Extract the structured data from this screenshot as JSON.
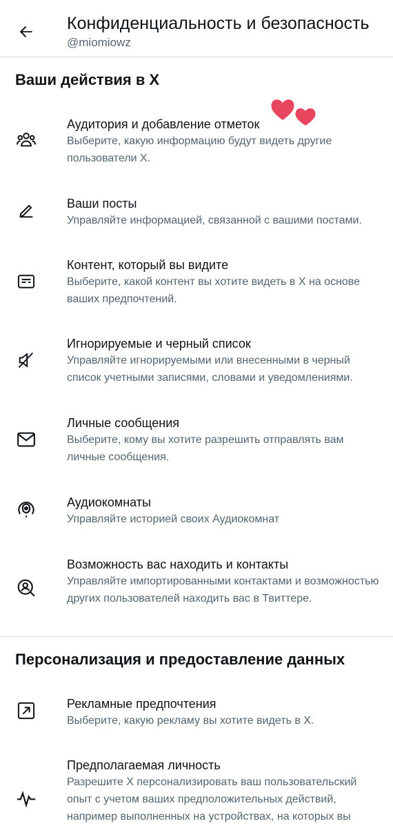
{
  "header": {
    "title": "Конфиденциальность и безопасность",
    "username": "@miomiowz"
  },
  "sections": [
    {
      "title": "Ваши действия в X",
      "items": [
        {
          "icon": "people-icon",
          "title": "Аудитория и добавление отметок",
          "description": "Выберите, какую информацию будут видеть другие пользователи X."
        },
        {
          "icon": "pencil-icon",
          "title": "Ваши посты",
          "description": "Управляйте информацией, связанной с вашими постами."
        },
        {
          "icon": "content-icon",
          "title": "Контент, который вы видите",
          "description": "Выберите, какой контент вы хотите видеть в X на основе ваших предпочтений."
        },
        {
          "icon": "mute-icon",
          "title": "Игнорируемые и черный список",
          "description": "Управляйте игнорируемыми или внесенными в черный список учетными записями, словами и уведомлениями."
        },
        {
          "icon": "envelope-icon",
          "title": "Личные сообщения",
          "description": "Выберите, кому вы хотите разрешить отправлять вам личные сообщения."
        },
        {
          "icon": "microphone-icon",
          "title": "Аудиокомнаты",
          "description": "Управляйте историей своих Аудиокомнат"
        },
        {
          "icon": "search-person-icon",
          "title": "Возможность вас находить и контакты",
          "description": "Управляйте импортированными контактами и возможностью других пользователей находить вас в Твиттере."
        }
      ]
    },
    {
      "title": "Персонализация и предоставление данных",
      "items": [
        {
          "icon": "ad-arrow-icon",
          "title": "Рекламные предпочтения",
          "description": "Выберите, какую рекламу вы хотите видеть в X."
        },
        {
          "icon": "activity-icon",
          "title": "Предполагаемая личность",
          "description": "Разрешите X персонализировать ваш пользовательский опыт с учетом ваших предположительных действий, например выполненных на устройствах, на которых вы"
        }
      ]
    }
  ],
  "colors": {
    "text": "#0f1419",
    "secondary": "#536471",
    "divider": "#cfd9de",
    "heart": "#e8455f"
  }
}
